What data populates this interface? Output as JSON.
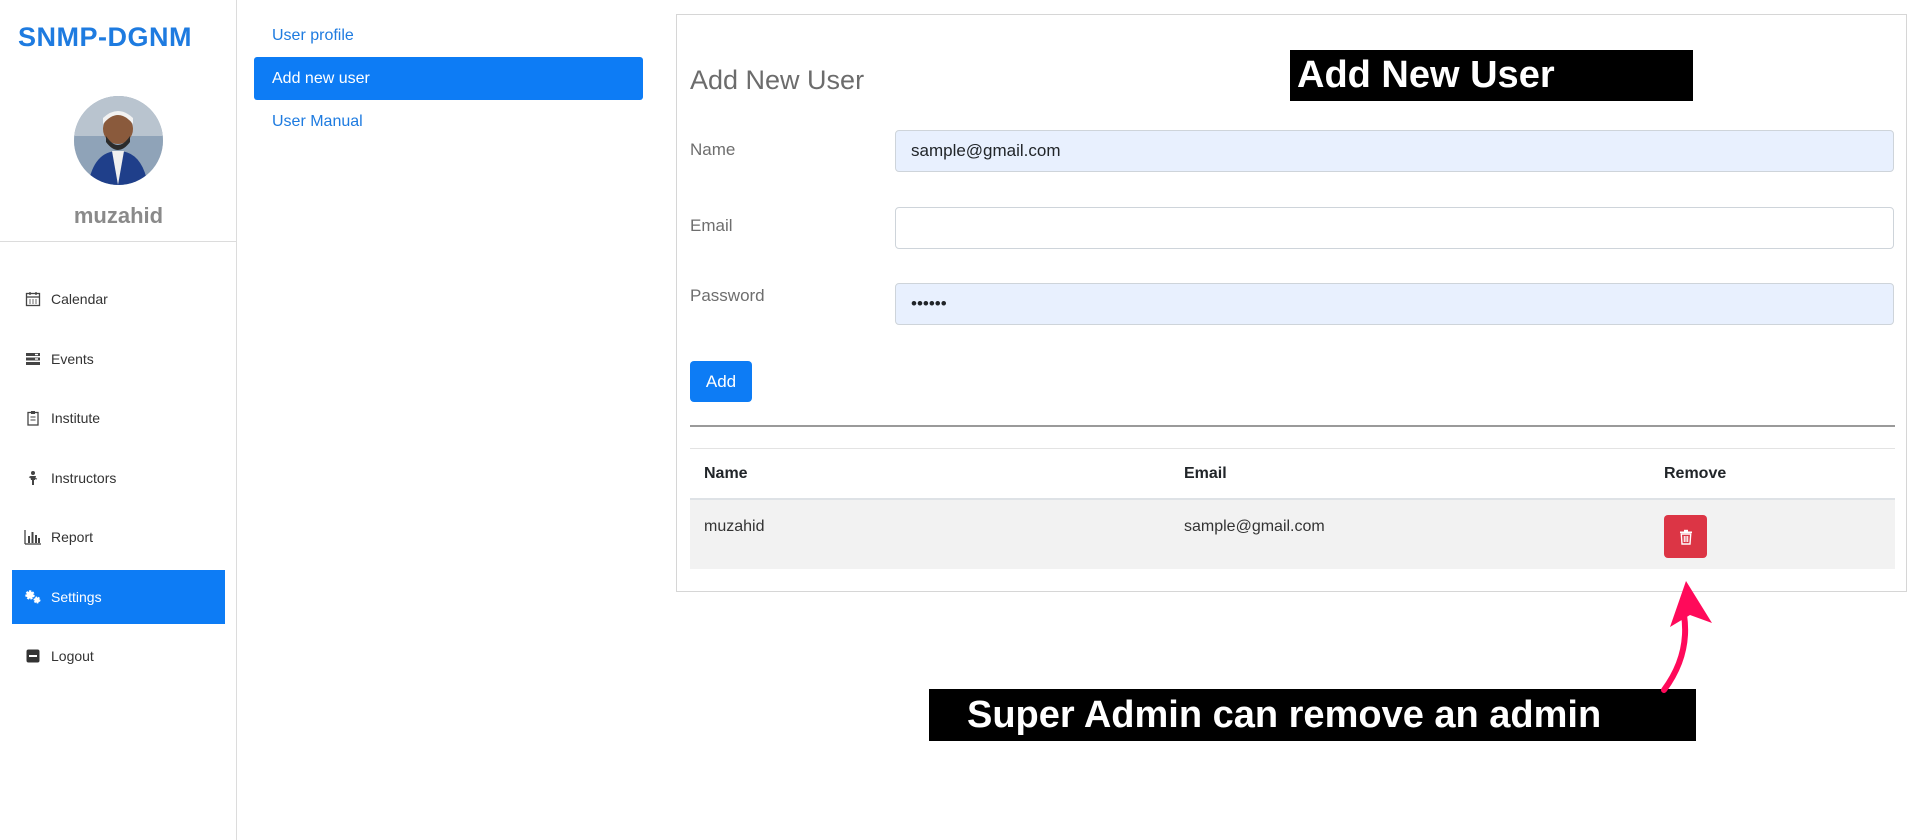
{
  "brand": "SNMP-DGNM",
  "user": {
    "name": "muzahid"
  },
  "sidebar": {
    "items": [
      {
        "label": "Calendar",
        "icon": "calendar-icon"
      },
      {
        "label": "Events",
        "icon": "events-icon"
      },
      {
        "label": "Institute",
        "icon": "institute-icon"
      },
      {
        "label": "Instructors",
        "icon": "instructor-icon"
      },
      {
        "label": "Report",
        "icon": "chart-icon"
      },
      {
        "label": "Settings",
        "icon": "gears-icon",
        "active": true
      },
      {
        "label": "Logout",
        "icon": "logout-icon"
      }
    ]
  },
  "subnav": {
    "items": [
      {
        "label": "User profile"
      },
      {
        "label": "Add new user",
        "active": true
      },
      {
        "label": "User Manual"
      }
    ]
  },
  "form": {
    "title": "Add New User",
    "name_label": "Name",
    "name_value": "sample@gmail.com",
    "email_label": "Email",
    "email_value": "",
    "password_label": "Password",
    "password_value": "••••••",
    "add_label": "Add"
  },
  "table": {
    "headers": [
      "Name",
      "Email",
      "Remove"
    ],
    "rows": [
      {
        "name": "muzahid",
        "email": "sample@gmail.com"
      }
    ]
  },
  "annotations": {
    "title": "Add New User",
    "note": "Super Admin can remove an admin"
  },
  "colors": {
    "brand": "#1e7be0",
    "primary": "#0d7cf5",
    "danger": "#dc3545",
    "arrow": "#ff0a5a"
  }
}
